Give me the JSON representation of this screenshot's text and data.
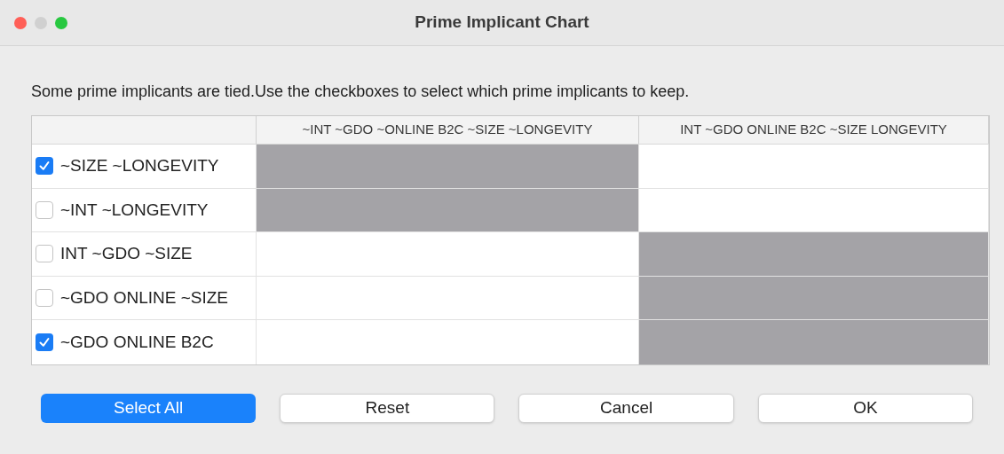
{
  "window": {
    "title": "Prime Implicant Chart"
  },
  "instruction": "Some prime implicants are tied.Use the checkboxes to select which prime implicants to keep.",
  "table": {
    "columns": [
      "~INT ~GDO ~ONLINE B2C ~SIZE ~LONGEVITY",
      "INT ~GDO ONLINE B2C ~SIZE LONGEVITY"
    ],
    "rows": [
      {
        "label": "~SIZE ~LONGEVITY",
        "checked": true,
        "cells": [
          {
            "covered": true
          },
          {
            "covered": false
          }
        ]
      },
      {
        "label": "~INT ~LONGEVITY",
        "checked": false,
        "cells": [
          {
            "covered": true
          },
          {
            "covered": false
          }
        ]
      },
      {
        "label": "INT ~GDO ~SIZE",
        "checked": false,
        "cells": [
          {
            "covered": false
          },
          {
            "covered": true
          }
        ]
      },
      {
        "label": "~GDO ONLINE ~SIZE",
        "checked": false,
        "cells": [
          {
            "covered": false
          },
          {
            "covered": true
          }
        ]
      },
      {
        "label": "~GDO ONLINE B2C",
        "checked": true,
        "cells": [
          {
            "covered": false
          },
          {
            "covered": true
          }
        ]
      }
    ]
  },
  "buttons": [
    {
      "label": "Select All",
      "kind": "primary"
    },
    {
      "label": "Reset",
      "kind": "default"
    },
    {
      "label": "Cancel",
      "kind": "default"
    },
    {
      "label": "OK",
      "kind": "default"
    }
  ]
}
